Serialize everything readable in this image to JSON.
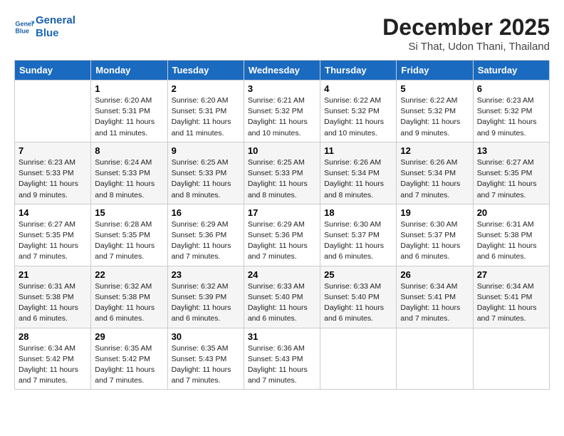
{
  "header": {
    "logo_line1": "General",
    "logo_line2": "Blue",
    "month": "December 2025",
    "location": "Si That, Udon Thani, Thailand"
  },
  "days_of_week": [
    "Sunday",
    "Monday",
    "Tuesday",
    "Wednesday",
    "Thursday",
    "Friday",
    "Saturday"
  ],
  "weeks": [
    [
      {
        "day": "",
        "info": ""
      },
      {
        "day": "1",
        "info": "Sunrise: 6:20 AM\nSunset: 5:31 PM\nDaylight: 11 hours\nand 11 minutes."
      },
      {
        "day": "2",
        "info": "Sunrise: 6:20 AM\nSunset: 5:31 PM\nDaylight: 11 hours\nand 11 minutes."
      },
      {
        "day": "3",
        "info": "Sunrise: 6:21 AM\nSunset: 5:32 PM\nDaylight: 11 hours\nand 10 minutes."
      },
      {
        "day": "4",
        "info": "Sunrise: 6:22 AM\nSunset: 5:32 PM\nDaylight: 11 hours\nand 10 minutes."
      },
      {
        "day": "5",
        "info": "Sunrise: 6:22 AM\nSunset: 5:32 PM\nDaylight: 11 hours\nand 9 minutes."
      },
      {
        "day": "6",
        "info": "Sunrise: 6:23 AM\nSunset: 5:32 PM\nDaylight: 11 hours\nand 9 minutes."
      }
    ],
    [
      {
        "day": "7",
        "info": "Sunrise: 6:23 AM\nSunset: 5:33 PM\nDaylight: 11 hours\nand 9 minutes."
      },
      {
        "day": "8",
        "info": "Sunrise: 6:24 AM\nSunset: 5:33 PM\nDaylight: 11 hours\nand 8 minutes."
      },
      {
        "day": "9",
        "info": "Sunrise: 6:25 AM\nSunset: 5:33 PM\nDaylight: 11 hours\nand 8 minutes."
      },
      {
        "day": "10",
        "info": "Sunrise: 6:25 AM\nSunset: 5:33 PM\nDaylight: 11 hours\nand 8 minutes."
      },
      {
        "day": "11",
        "info": "Sunrise: 6:26 AM\nSunset: 5:34 PM\nDaylight: 11 hours\nand 8 minutes."
      },
      {
        "day": "12",
        "info": "Sunrise: 6:26 AM\nSunset: 5:34 PM\nDaylight: 11 hours\nand 7 minutes."
      },
      {
        "day": "13",
        "info": "Sunrise: 6:27 AM\nSunset: 5:35 PM\nDaylight: 11 hours\nand 7 minutes."
      }
    ],
    [
      {
        "day": "14",
        "info": "Sunrise: 6:27 AM\nSunset: 5:35 PM\nDaylight: 11 hours\nand 7 minutes."
      },
      {
        "day": "15",
        "info": "Sunrise: 6:28 AM\nSunset: 5:35 PM\nDaylight: 11 hours\nand 7 minutes."
      },
      {
        "day": "16",
        "info": "Sunrise: 6:29 AM\nSunset: 5:36 PM\nDaylight: 11 hours\nand 7 minutes."
      },
      {
        "day": "17",
        "info": "Sunrise: 6:29 AM\nSunset: 5:36 PM\nDaylight: 11 hours\nand 7 minutes."
      },
      {
        "day": "18",
        "info": "Sunrise: 6:30 AM\nSunset: 5:37 PM\nDaylight: 11 hours\nand 6 minutes."
      },
      {
        "day": "19",
        "info": "Sunrise: 6:30 AM\nSunset: 5:37 PM\nDaylight: 11 hours\nand 6 minutes."
      },
      {
        "day": "20",
        "info": "Sunrise: 6:31 AM\nSunset: 5:38 PM\nDaylight: 11 hours\nand 6 minutes."
      }
    ],
    [
      {
        "day": "21",
        "info": "Sunrise: 6:31 AM\nSunset: 5:38 PM\nDaylight: 11 hours\nand 6 minutes."
      },
      {
        "day": "22",
        "info": "Sunrise: 6:32 AM\nSunset: 5:38 PM\nDaylight: 11 hours\nand 6 minutes."
      },
      {
        "day": "23",
        "info": "Sunrise: 6:32 AM\nSunset: 5:39 PM\nDaylight: 11 hours\nand 6 minutes."
      },
      {
        "day": "24",
        "info": "Sunrise: 6:33 AM\nSunset: 5:40 PM\nDaylight: 11 hours\nand 6 minutes."
      },
      {
        "day": "25",
        "info": "Sunrise: 6:33 AM\nSunset: 5:40 PM\nDaylight: 11 hours\nand 6 minutes."
      },
      {
        "day": "26",
        "info": "Sunrise: 6:34 AM\nSunset: 5:41 PM\nDaylight: 11 hours\nand 7 minutes."
      },
      {
        "day": "27",
        "info": "Sunrise: 6:34 AM\nSunset: 5:41 PM\nDaylight: 11 hours\nand 7 minutes."
      }
    ],
    [
      {
        "day": "28",
        "info": "Sunrise: 6:34 AM\nSunset: 5:42 PM\nDaylight: 11 hours\nand 7 minutes."
      },
      {
        "day": "29",
        "info": "Sunrise: 6:35 AM\nSunset: 5:42 PM\nDaylight: 11 hours\nand 7 minutes."
      },
      {
        "day": "30",
        "info": "Sunrise: 6:35 AM\nSunset: 5:43 PM\nDaylight: 11 hours\nand 7 minutes."
      },
      {
        "day": "31",
        "info": "Sunrise: 6:36 AM\nSunset: 5:43 PM\nDaylight: 11 hours\nand 7 minutes."
      },
      {
        "day": "",
        "info": ""
      },
      {
        "day": "",
        "info": ""
      },
      {
        "day": "",
        "info": ""
      }
    ]
  ]
}
